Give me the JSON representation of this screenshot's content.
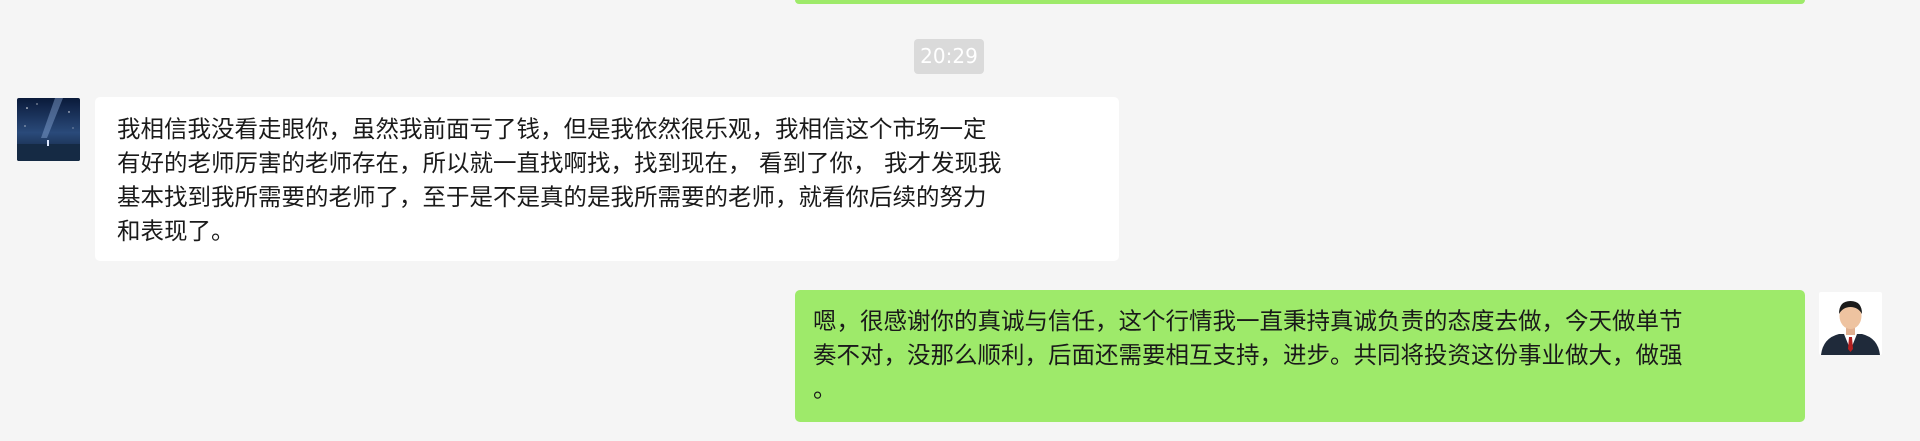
{
  "chat": {
    "timestamp": "20:29",
    "messages": [
      {
        "side": "left",
        "text": "我相信我没看走眼你，虽然我前面亏了钱，但是我依然很乐观，我相信这个市场一定\n有好的老师厉害的老师存在，所以就一直找啊找，找到现在， 看到了你， 我才发现我\n基本找到我所需要的老师了，至于是不是真的是我所需要的老师，就看你后续的努力\n和表现了。"
      },
      {
        "side": "right",
        "text": "嗯，很感谢你的真诚与信任，这个行情我一直秉持真诚负责的态度去做，今天做单节\n奏不对，没那么顺利，后面还需要相互支持，进步。共同将投资这份事业做大，做强\n。"
      }
    ]
  },
  "colors": {
    "background": "#f5f5f5",
    "outgoing_bubble": "#9eea6a",
    "incoming_bubble": "#ffffff",
    "timestamp_bg": "#dadada"
  }
}
